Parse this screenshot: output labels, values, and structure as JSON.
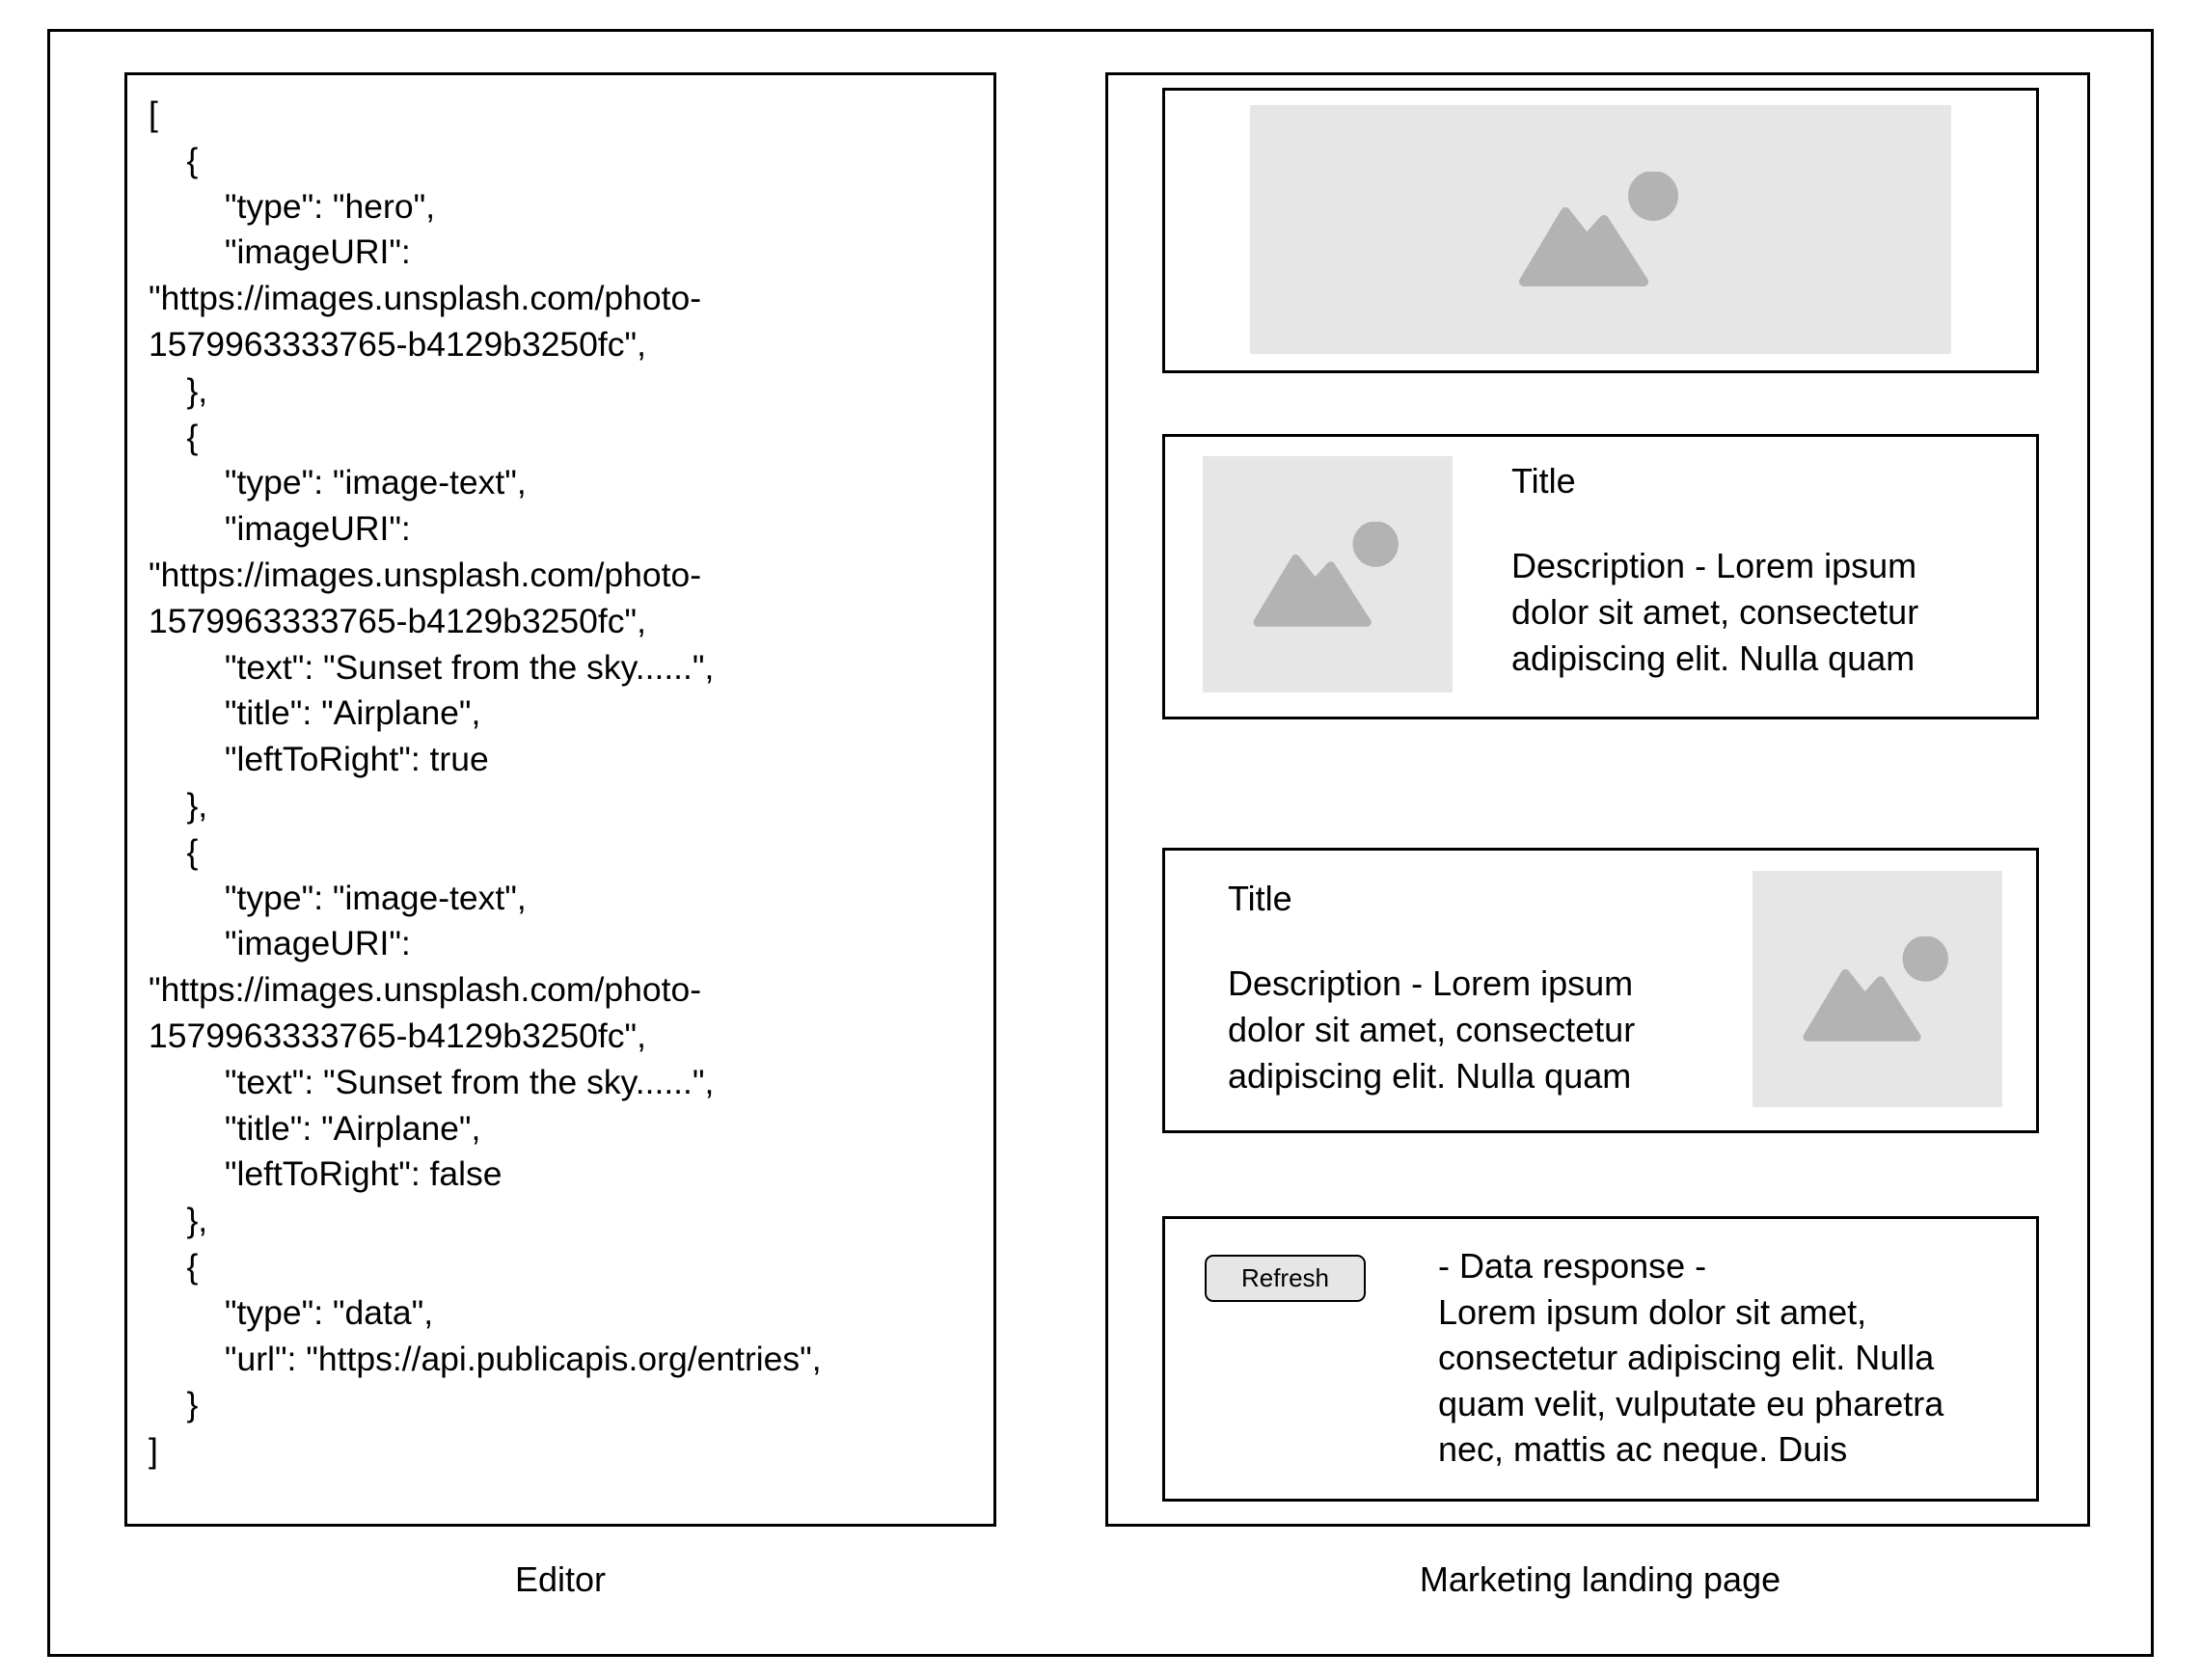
{
  "editor": {
    "caption": "Editor",
    "code_lines": [
      "[",
      "    {",
      "        \"type\": \"hero\",",
      "        \"imageURI\":",
      "\"https://images.unsplash.com/photo-",
      "1579963333765-b4129b3250fc\",",
      "    },",
      "    {",
      "        \"type\": \"image-text\",",
      "        \"imageURI\":",
      "\"https://images.unsplash.com/photo-",
      "1579963333765-b4129b3250fc\",",
      "        \"text\": \"Sunset from the sky......\",",
      "        \"title\": \"Airplane\",",
      "        \"leftToRight\": true",
      "    },",
      "    {",
      "        \"type\": \"image-text\",",
      "        \"imageURI\":",
      "\"https://images.unsplash.com/photo-",
      "1579963333765-b4129b3250fc\",",
      "        \"text\": \"Sunset from the sky......\",",
      "        \"title\": \"Airplane\",",
      "        \"leftToRight\": false",
      "    },",
      "    {",
      "        \"type\": \"data\",",
      "        \"url\": \"https://api.publicapis.org/entries\",",
      "    }",
      "]"
    ]
  },
  "landing": {
    "caption": "Marketing landing page",
    "block1": {
      "title": "Title",
      "description": "Description - Lorem ipsum dolor sit amet, consectetur adipiscing elit. Nulla quam"
    },
    "block2": {
      "title": "Title",
      "description": "Description - Lorem ipsum dolor sit amet, consectetur adipiscing elit. Nulla quam"
    },
    "data_block": {
      "button_label": "Refresh",
      "heading": "- Data response -",
      "body": "Lorem ipsum dolor sit amet, consectetur adipiscing elit. Nulla quam velit, vulputate eu pharetra nec, mattis ac neque. Duis"
    }
  },
  "colors": {
    "image_placeholder_bg": "#e6e6e6",
    "image_icon": "#b3b3b3",
    "button_bg": "#e6e6e6"
  },
  "icons": {
    "image_placeholder": "image-icon"
  }
}
